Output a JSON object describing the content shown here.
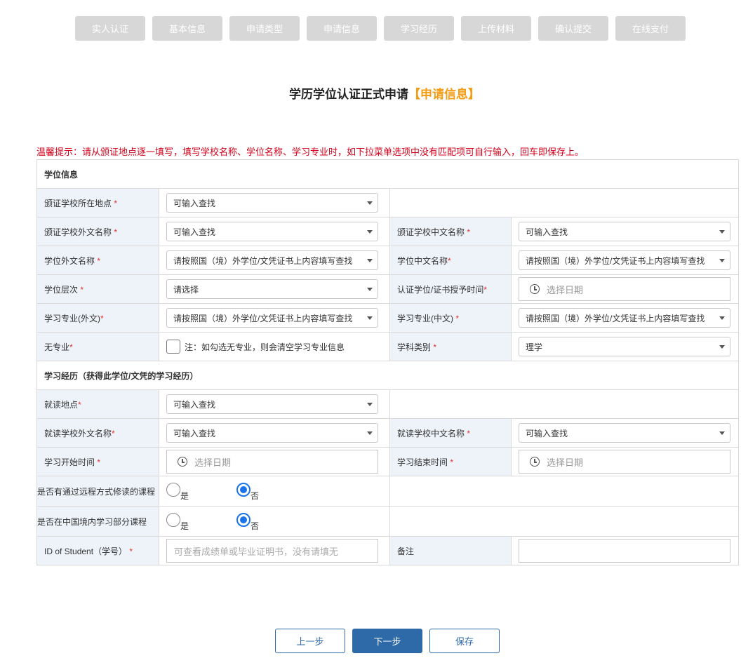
{
  "steps": [
    "实人认证",
    "基本信息",
    "申请类型",
    "申请信息",
    "学习经历",
    "上传材料",
    "确认提交",
    "在线支付"
  ],
  "title": {
    "main": "学历学位认证正式申请",
    "highlight": "【申请信息】"
  },
  "tip": "温馨提示：请从颁证地点逐一填写，填写学校名称、学位名称、学习专业时，如下拉菜单选项中没有匹配项可自行输入，回车即保存上。",
  "section1": "学位信息",
  "section2": "学习经历（获得此学位/文凭的学习经历）",
  "fields": {
    "issue_location": {
      "label": "颁证学校所在地点",
      "req": "*",
      "value": "可输入查找"
    },
    "issue_school_foreign": {
      "label": "颁证学校外文名称",
      "req": "*",
      "value": "可输入查找"
    },
    "issue_school_cn": {
      "label": "颁证学校中文名称",
      "req": "*",
      "value": "可输入查找"
    },
    "degree_foreign": {
      "label": "学位外文名称",
      "req": "*",
      "value": "请按照国（境）外学位/文凭证书上内容填写查找"
    },
    "degree_cn": {
      "label": "学位中文名称",
      "req": "*",
      "value": "请按照国（境）外学位/文凭证书上内容填写查找"
    },
    "degree_level": {
      "label": "学位层次",
      "req": "*",
      "value": "请选择"
    },
    "award_time": {
      "label": "认证学位/证书授予时间",
      "req": "*",
      "value": "选择日期"
    },
    "major_foreign": {
      "label": "学习专业(外文)",
      "req": "*",
      "value": "请按照国（境）外学位/文凭证书上内容填写查找"
    },
    "major_cn": {
      "label": "学习专业(中文)",
      "req": "*",
      "value": "请按照国（境）外学位/文凭证书上内容填写查找"
    },
    "no_major": {
      "label": "无专业",
      "req": "*",
      "note": "注：如勾选无专业，则会清空学习专业信息"
    },
    "subject": {
      "label": "学科类别",
      "req": "*",
      "value": "理学"
    },
    "study_location": {
      "label": "就读地点",
      "req": "*",
      "value": "可输入查找"
    },
    "study_school_foreign": {
      "label": "就读学校外文名称",
      "req": "*",
      "value": "可输入查找"
    },
    "study_school_cn": {
      "label": "就读学校中文名称",
      "req": "*",
      "value": "可输入查找"
    },
    "start_time": {
      "label": "学习开始时间",
      "req": "*",
      "value": "选择日期"
    },
    "end_time": {
      "label": "学习结束时间",
      "req": "*",
      "value": "选择日期"
    },
    "remote": {
      "label": "是否有通过远程方式修读的课程",
      "yes": "是",
      "no": "否"
    },
    "domestic": {
      "label": "是否在中国境内学习部分课程",
      "yes": "是",
      "no": "否"
    },
    "student_id": {
      "label": "ID of Student（学号）",
      "req": "*",
      "placeholder": "可查看成绩单或毕业证明书，没有请填无"
    },
    "remark": {
      "label": "备注"
    }
  },
  "buttons": {
    "prev": "上一步",
    "next": "下一步",
    "save": "保存"
  }
}
